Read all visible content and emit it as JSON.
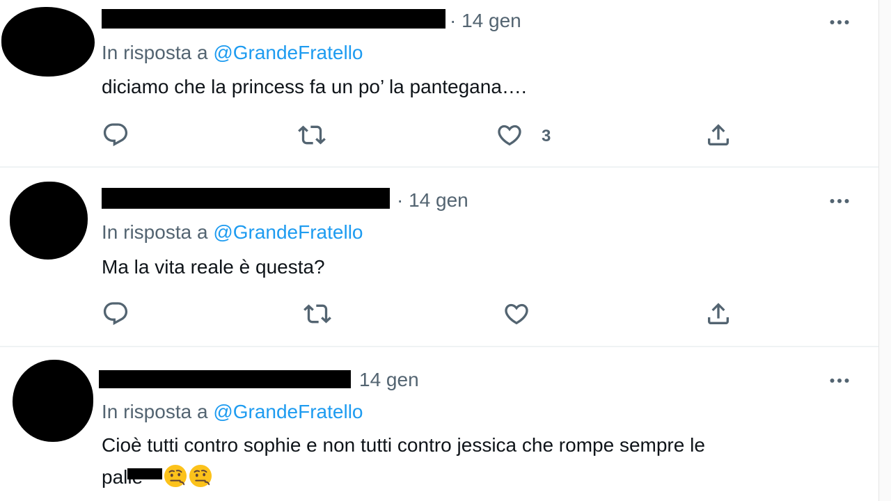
{
  "tweets": [
    {
      "time": "· 14 gen",
      "reply_prefix": "In risposta a",
      "reply_handle": "@GrandeFratello",
      "text": "diciamo che la princess fa un po’ la pantegana….",
      "like_count": "3"
    },
    {
      "time": "· 14 gen",
      "reply_prefix": "In risposta a",
      "reply_handle": "@GrandeFratello",
      "text": "Ma la vita reale è questa?",
      "like_count": ""
    },
    {
      "time": "14 gen",
      "reply_prefix": "In risposta a",
      "reply_handle": "@GrandeFratello",
      "text_line1": "Cioè tutti contro sophie e non tutti contro jessica che rompe sempre le",
      "text_line2": "palle"
    }
  ],
  "icons": {
    "reply": "reply-icon",
    "retweet": "retweet-icon",
    "like": "heart-icon",
    "share": "share-icon",
    "more": "more-icon"
  },
  "colors": {
    "link": "#1d9bf0",
    "muted": "#536471",
    "text": "#0f1419"
  }
}
